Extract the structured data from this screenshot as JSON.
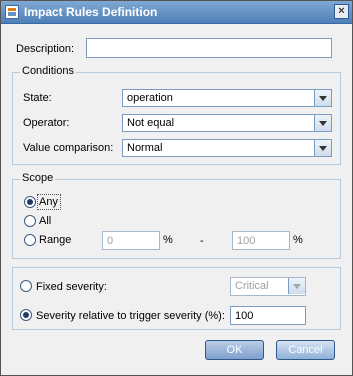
{
  "window": {
    "title": "Impact Rules Definition",
    "close_glyph": "×"
  },
  "description": {
    "label": "Description:",
    "value": ""
  },
  "conditions": {
    "legend": "Conditions",
    "state": {
      "label": "State:",
      "value": "operation"
    },
    "operator": {
      "label": "Operator:",
      "value": "Not equal"
    },
    "value_comparison": {
      "label": "Value comparison:",
      "value": "Normal"
    }
  },
  "scope": {
    "legend": "Scope",
    "options": {
      "any": "Any",
      "all": "All",
      "range": "Range"
    },
    "selected": "any",
    "range_from": "0",
    "range_to": "100",
    "percent": "%",
    "dash": "-"
  },
  "severity": {
    "fixed_label": "Fixed severity:",
    "fixed_value": "Critical",
    "relative_label": "Severity relative to trigger severity (%):",
    "relative_value": "100",
    "selected": "relative"
  },
  "buttons": {
    "ok": "OK",
    "cancel": "Cancel"
  },
  "icons": {
    "title_icon": "dialog-icon",
    "close": "close-icon",
    "dropdown": "chevron-down-icon"
  }
}
